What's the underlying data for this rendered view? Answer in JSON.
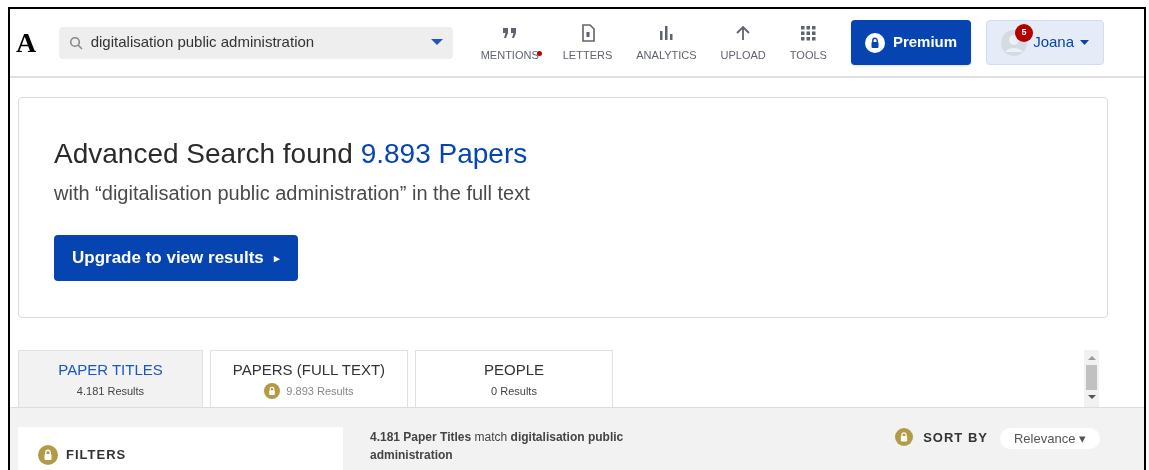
{
  "logo": "A",
  "search": {
    "value": "digitalisation public administration"
  },
  "nav": [
    {
      "kind": "quote",
      "label": "MENTIONS",
      "dot": true
    },
    {
      "kind": "letter",
      "label": "LETTERS",
      "dot": false
    },
    {
      "kind": "chart",
      "label": "ANALYTICS",
      "dot": false
    },
    {
      "kind": "upload",
      "label": "UPLOAD",
      "dot": false
    },
    {
      "kind": "grid",
      "label": "TOOLS",
      "dot": false
    }
  ],
  "premium": {
    "label": "Premium"
  },
  "user": {
    "name": "Joana",
    "notifications": "5"
  },
  "headline": {
    "text": "Advanced Search found",
    "highlight": "9.893 Papers"
  },
  "subline": "with “digitalisation public administration” in the full text",
  "upgrade": {
    "label": "Upgrade to view results",
    "arrow": "▸"
  },
  "tabs": [
    {
      "title": "PAPER TITLES",
      "results": "4.181 Results",
      "locked": false,
      "selected": true
    },
    {
      "title": "PAPERS (FULL TEXT)",
      "results": "9.893 Results",
      "locked": true,
      "selected": false
    },
    {
      "title": "PEOPLE",
      "results": "0 Results",
      "locked": false,
      "selected": false
    }
  ],
  "filters": {
    "label": "FILTERS",
    "locked": true
  },
  "match": "**4.181 Paper Titles** match **digitalisation public administration**",
  "sort": {
    "label": "SORT BY",
    "locked": true,
    "value": "Relevance ▾"
  }
}
